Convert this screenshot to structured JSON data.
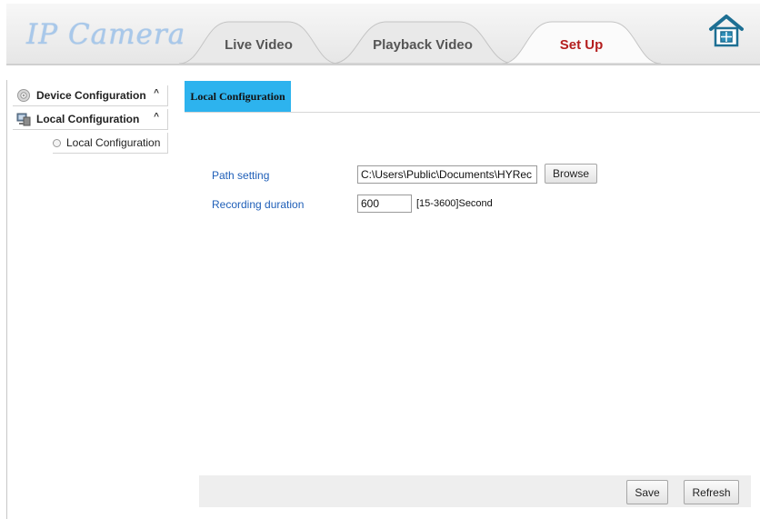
{
  "header": {
    "logo_text": "IP Camera",
    "tabs": [
      {
        "label": "Live Video",
        "active": false
      },
      {
        "label": "Playback Video",
        "active": false
      },
      {
        "label": "Set Up",
        "active": true
      }
    ],
    "home_icon": "home-icon"
  },
  "sidebar": {
    "items": [
      {
        "label": "Device Configuration",
        "icon": "gear-icon",
        "chevron": "^"
      },
      {
        "label": "Local Configuration",
        "icon": "computer-icon",
        "chevron": "^"
      }
    ],
    "sub_items": [
      {
        "label": "Local Configuration"
      }
    ]
  },
  "main": {
    "tab_label": "Local Configuration",
    "path_setting": {
      "label": "Path setting",
      "value": "C:\\Users\\Public\\Documents\\HYRec",
      "browse_label": "Browse"
    },
    "recording_duration": {
      "label": "Recording duration",
      "value": "600",
      "hint": "[15-3600]Second"
    }
  },
  "footer": {
    "save_label": "Save",
    "refresh_label": "Refresh"
  },
  "colors": {
    "active_tab": "#2db3ee",
    "setup_tab_text": "#b41e1e",
    "form_label": "#1f5fb8",
    "logo": "#a8c8ea"
  }
}
